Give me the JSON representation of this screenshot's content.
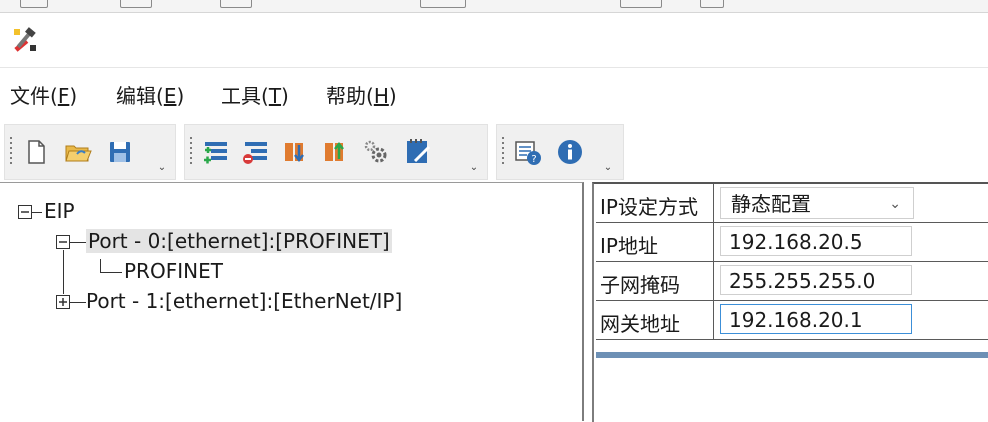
{
  "menu": {
    "file": "文件(",
    "file_key": "F",
    "edit": "编辑(",
    "edit_key": "E",
    "tools": "工具(",
    "tools_key": "T",
    "help": "帮助(",
    "help_key": "H",
    "close_paren": ")"
  },
  "tree": {
    "root": "EIP",
    "port0": "Port - 0:[ethernet]:[PROFINET]",
    "port0_child": "PROFINET",
    "port1": "Port - 1:[ethernet]:[EtherNet/IP]"
  },
  "properties": {
    "ip_mode_label": "IP设定方式",
    "ip_mode_value": "静态配置",
    "ip_label": "IP地址",
    "ip_value": "192.168.20.5",
    "mask_label": "子网掩码",
    "mask_value": "255.255.255.0",
    "gateway_label": "网关地址",
    "gateway_value": "192.168.20.1"
  },
  "colors": {
    "accent_blue": "#3c8fd8",
    "selection": "#e4e4e4"
  },
  "icons": [
    "app-tools-icon",
    "new-file-icon",
    "open-folder-icon",
    "save-icon",
    "add-node-icon",
    "remove-node-icon",
    "download-icon",
    "upload-icon",
    "settings-gears-icon",
    "edit-note-icon",
    "config-help-icon",
    "info-icon"
  ]
}
